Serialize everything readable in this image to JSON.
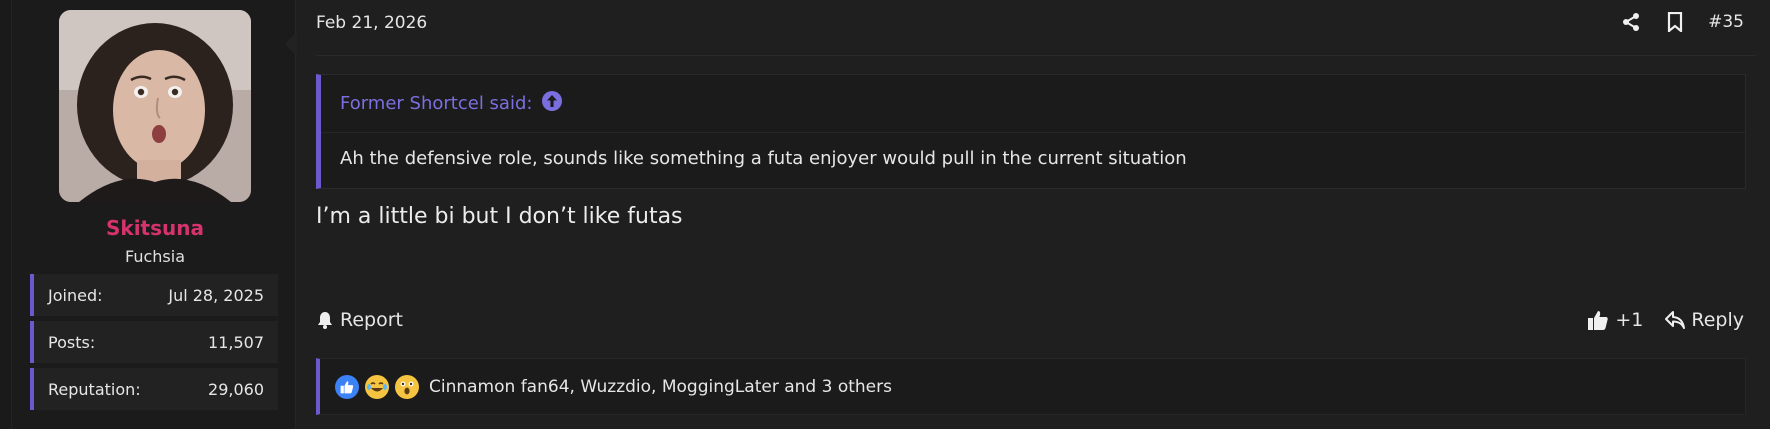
{
  "user": {
    "name": "Skitsuna",
    "title": "Fuchsia",
    "stats": [
      {
        "label": "Joined:",
        "value": "Jul 28, 2025"
      },
      {
        "label": "Posts:",
        "value": "11,507"
      },
      {
        "label": "Reputation:",
        "value": "29,060"
      }
    ],
    "name_color": "#d6336c"
  },
  "post": {
    "date": "Feb 21, 2026",
    "number": "#35",
    "quote": {
      "author_line": "Former Shortcel said:",
      "text": "Ah the defensive role, sounds like something a futa enjoyer would pull in the current situation"
    },
    "message": "I’m a little bi but I don’t like futas",
    "actions": {
      "report_label": "Report",
      "like_label": "+1",
      "reply_label": "Reply"
    },
    "reactions": {
      "icons": [
        "thumbs-up-reaction",
        "laugh-cry-reaction",
        "astonished-reaction"
      ],
      "summary": "Cinnamon fan64, Wuzzdio, MoggingLater and 3 others"
    }
  },
  "colors": {
    "accent": "#6a5acd",
    "background": "#1f1f1f",
    "quote_author": "#7b6fe0"
  }
}
